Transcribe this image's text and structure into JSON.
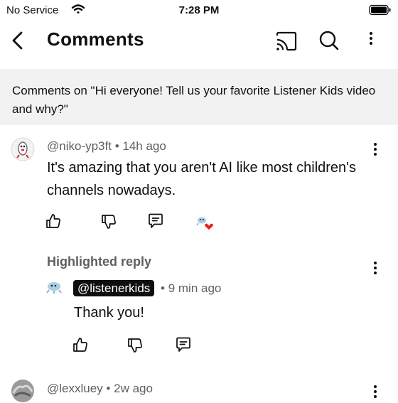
{
  "status_bar": {
    "carrier": "No Service",
    "time": "7:28 PM"
  },
  "header": {
    "title": "Comments"
  },
  "banner": {
    "text": "Comments on \"Hi everyone! Tell us your favorite Listener Kids video and why?\""
  },
  "comments": [
    {
      "author": "@niko-yp3ft",
      "separator": "•",
      "age": "14h ago",
      "text": "It's amazing that you aren't AI like most children's channels nowadays.",
      "reply": {
        "label": "Highlighted reply",
        "author": "@listenerkids",
        "separator": "•",
        "age": "9 min ago",
        "text": "Thank you!"
      }
    },
    {
      "author": "@lexxluey",
      "separator": "•",
      "age": "2w ago"
    }
  ],
  "icons": {
    "back": "back-arrow-icon",
    "cast": "cast-icon",
    "search": "search-icon",
    "more": "more-vertical-icon",
    "like": "thumbs-up-icon",
    "dislike": "thumbs-down-icon",
    "reply": "reply-icon",
    "creator_heart": "creator-heart-icon"
  },
  "colors": {
    "heart": "#e62117",
    "banner_bg": "#f2f2f2",
    "meta_text": "#606060",
    "chip_bg": "#0f0f0f"
  }
}
